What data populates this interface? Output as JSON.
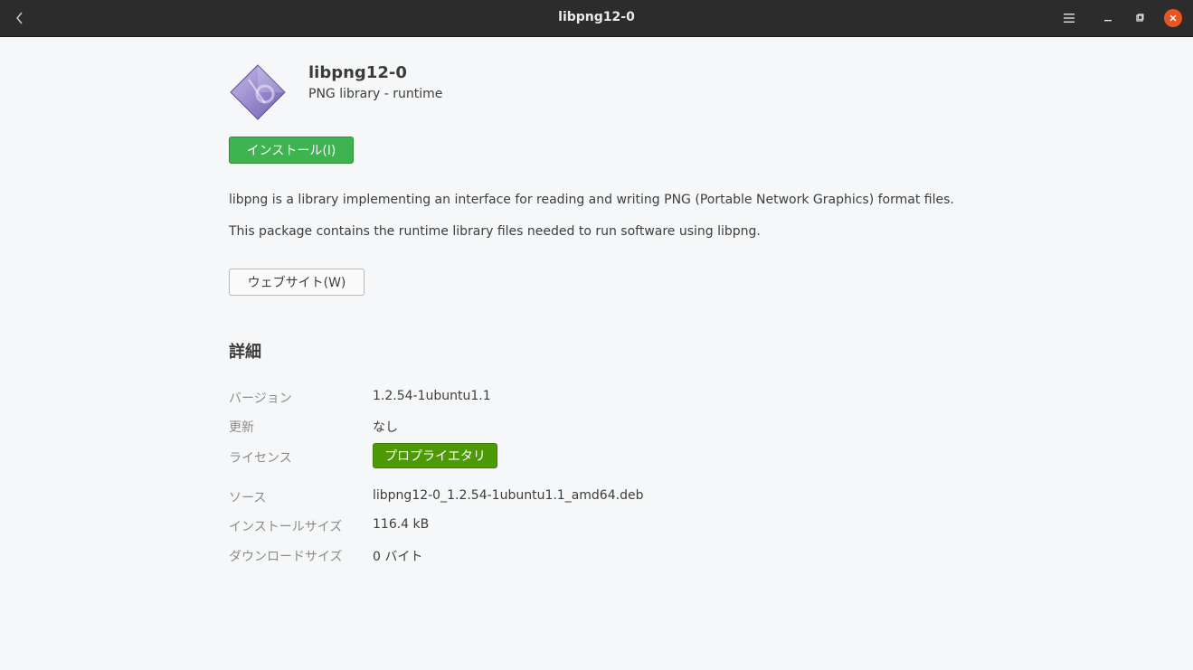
{
  "window": {
    "title": "libpng12-0"
  },
  "icons": {
    "back": "chevron-left-icon",
    "menu": "hamburger-menu-icon",
    "minimize": "minimize-icon",
    "maximize": "maximize-icon",
    "close": "close-icon",
    "app": "package-icon"
  },
  "colors": {
    "install_button": "#3eb34f",
    "license_badge": "#4e9a06",
    "close_button": "#e95420",
    "titlebar": "#2c2c2c"
  },
  "app": {
    "name": "libpng12-0",
    "summary": "PNG library - runtime",
    "install_label": "インストール(I)",
    "description": [
      "libpng is a library implementing an interface for reading and writing PNG (Portable Network Graphics) format files.",
      "This package contains the runtime library files needed to run software using libpng."
    ],
    "website_label": "ウェブサイト(W)"
  },
  "details": {
    "heading": "詳細",
    "rows": [
      {
        "label": "バージョン",
        "value": "1.2.54-1ubuntu1.1"
      },
      {
        "label": "更新",
        "value": "なし"
      },
      {
        "label": "ライセンス",
        "value": "プロプライエタリ"
      },
      {
        "label": "ソース",
        "value": "libpng12-0_1.2.54-1ubuntu1.1_amd64.deb"
      },
      {
        "label": "インストールサイズ",
        "value": "116.4 kB"
      },
      {
        "label": "ダウンロードサイズ",
        "value": "0 バイト"
      }
    ]
  }
}
